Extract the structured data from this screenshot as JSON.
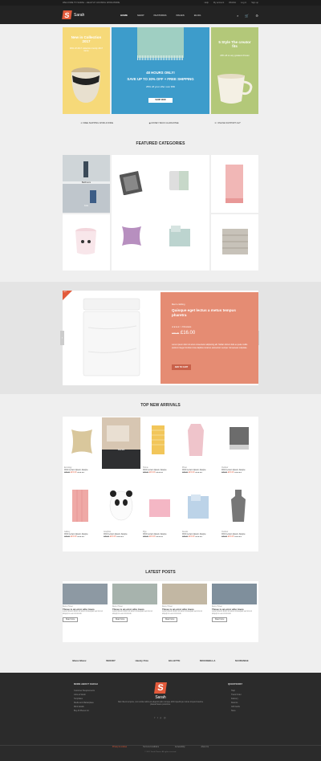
{
  "topbar": {
    "left": "WELCOME TO SARAH - HEALTHY HOUSING WORLDWIDE",
    "links": [
      "Help",
      "My account",
      "Wishlist",
      "Log in",
      "Sign up"
    ]
  },
  "header": {
    "logo": "Sarah",
    "nav": [
      "HOME",
      "SHOP",
      "FEATURES",
      "PAGES",
      "BLOG"
    ]
  },
  "banners": {
    "left": {
      "title": "New in Collection 2017",
      "sub": "30% off 2017 collection trendy 2017 items"
    },
    "center": {
      "line1": "48 HOURS ONLY!",
      "line2": "SAVE UP TO 30% OFF + FREE SHIPPING",
      "line3": "25% off your offer over $50",
      "button": "SHOP NOW"
    },
    "right": {
      "title": "5 Style The creator fits",
      "sub": "20% off on any greatest chosen"
    }
  },
  "features": [
    "FREE SHIPPING WORLD WIDE",
    "MONEY BACK GUARANTEE",
    "ONLINE SUPPORT 24/7"
  ],
  "featured": {
    "title": "FEATURED CATEGORIES",
    "labels": [
      "Bathroom",
      "Kids"
    ]
  },
  "deal": {
    "badge": "HOT",
    "category": "Men's clothing",
    "title": "Quisque eget lectus a metus tempus pharetra",
    "reviews": "2 Reviews",
    "old": "£35.00",
    "price": "£16.00",
    "text": "Lorem ipsum dolor sit amet consectetur adipiscing elit. Nullam dictum felis eu pede mollis pretium integer tincidunt cras dapibus vivamus elementum semper nisi aenean vulputate.",
    "button": "ADD TO CART"
  },
  "arrivals": {
    "title": "TOP NEW ARRIVALS",
    "category_label": "Decals",
    "products": [
      {
        "cat": "Ecoology",
        "name": "OCC Lorem Ipsum Juscpe",
        "old": "£35.00",
        "price": "£15.00"
      },
      {
        "cat": "",
        "name": "",
        "old": "",
        "price": ""
      },
      {
        "cat": "Homie",
        "name": "OCC Lorem Ipsum Juscpe",
        "old": "£35.00",
        "price": "£15.00"
      },
      {
        "cat": "Pictet",
        "name": "OCC Lorem Ipsum Juscpe",
        "old": "£35.00",
        "price": "£15.00"
      },
      {
        "cat": "Outdoor",
        "name": "OCC Lorem Ipsum Juscpe",
        "old": "£35.00",
        "price": "£15.00"
      },
      {
        "cat": "Gallery",
        "name": "OCC Lorem Ipsum Juscpe",
        "old": "£35.00",
        "price": "£15.00"
      },
      {
        "cat": "Graphics",
        "name": "OCC Lorem Ipsum Juscpe",
        "old": "£35.00",
        "price": "£15.00"
      },
      {
        "cat": "Pigs",
        "name": "OCC Lorem Ipsum Juscpe",
        "old": "£35.00",
        "price": "£15.00"
      },
      {
        "cat": "Decals",
        "name": "OCC Lorem Ipsum Juscpe",
        "old": "£35.00",
        "price": "£15.00"
      },
      {
        "cat": "Outdoor",
        "name": "OCC Lorem Ipsum Juscpe",
        "old": "£35.00",
        "price": "£15.00"
      }
    ]
  },
  "posts": {
    "title": "LATEST POSTS",
    "items": [
      {
        "meta": "Deco, Hover",
        "title": "Those is an error who loves",
        "text": "Lorem ipsum dolor sit amet consequat sed nisi ut aliquip ex ea commodo",
        "btn": "Read more"
      },
      {
        "meta": "Deco, Hover",
        "title": "Those is an error who loves",
        "text": "Lorem ipsum dolor sit amet consequat sed nisi ut aliquip ex ea commodo",
        "btn": "Read more"
      },
      {
        "meta": "Deco, Hover",
        "title": "Those is an error who loves",
        "text": "Lorem ipsum dolor sit amet consequat sed nisi ut aliquip ex ea commodo",
        "btn": "Read more"
      },
      {
        "meta": "Deco, Hover",
        "title": "Those is an error who loves",
        "text": "Lorem ipsum dolor sit amet consequat sed nisi ut aliquip ex ea commodo",
        "btn": "Read more"
      }
    ]
  },
  "brands": [
    "Blanc Blanc",
    "WOODY",
    "Handy Polo",
    "GILLETTE",
    "MOCOBELLA",
    "M.ORANGE"
  ],
  "footer": {
    "left_title": "MORE ABOUT SARAH",
    "left_links": [
      "Customer Requirements",
      "Jobs at Sarah",
      "Templates",
      "Media and Marketplace",
      "Mind details",
      "Buy All Pieces Inc"
    ],
    "logo": "Sarah",
    "about": "Nam libero tempore, cum soluta nobis est eligendi optio cumque nihil impedit quo minus id quod maxime placeat facere possimus.",
    "right_title": "QUESTIONS?",
    "right_links": [
      "Help",
      "Track Order",
      "Delivery",
      "Returns",
      "Gift Cards",
      "Store"
    ],
    "bottom_links": [
      "Privacy & cookies",
      "Terms & Conditions",
      "Accessibility",
      "About Us"
    ],
    "copyright": "© 2017 SarahTheme. All rights reserved."
  }
}
